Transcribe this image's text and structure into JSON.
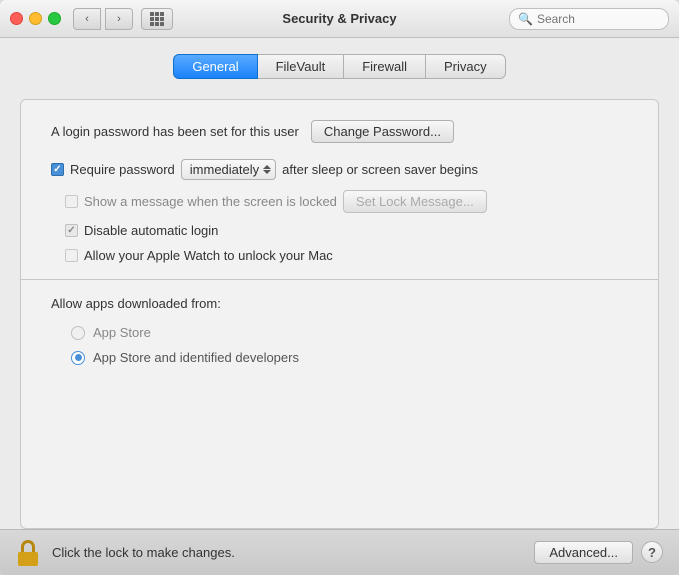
{
  "titlebar": {
    "title": "Security & Privacy",
    "search_placeholder": "Search",
    "back_button": "‹",
    "forward_button": "›"
  },
  "tabs": [
    {
      "id": "general",
      "label": "General",
      "active": true
    },
    {
      "id": "filevault",
      "label": "FileVault",
      "active": false
    },
    {
      "id": "firewall",
      "label": "Firewall",
      "active": false
    },
    {
      "id": "privacy",
      "label": "Privacy",
      "active": false
    }
  ],
  "panel": {
    "login_label": "A login password has been set for this user",
    "change_password_btn": "Change Password...",
    "require_password_label": "Require password",
    "password_timing": "immediately",
    "after_sleep_label": "after sleep or screen saver begins",
    "show_message_label": "Show a message when the screen is locked",
    "set_lock_message_btn": "Set Lock Message...",
    "disable_auto_login_label": "Disable automatic login",
    "apple_watch_label": "Allow your Apple Watch to unlock your Mac",
    "apps_title": "Allow apps downloaded from:",
    "app_store_label": "App Store",
    "app_store_identified_label": "App Store and identified developers"
  },
  "bottombar": {
    "lock_label": "Click the lock to make changes.",
    "advanced_btn": "Advanced...",
    "help_btn": "?"
  }
}
